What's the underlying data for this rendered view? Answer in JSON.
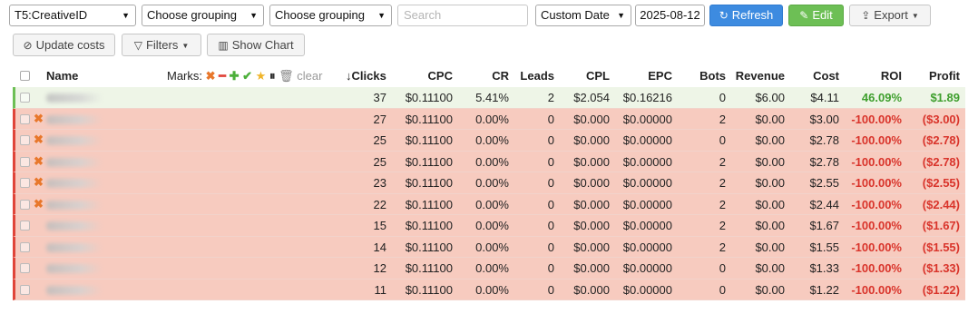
{
  "toolbar": {
    "grouping1": "T5:CreativeID",
    "grouping2": "Choose grouping",
    "grouping3": "Choose grouping",
    "search_placeholder": "Search",
    "date_range": "Custom Date",
    "date_value": "2025-08-12",
    "refresh_label": "Refresh",
    "edit_label": "Edit",
    "export_label": "Export"
  },
  "toolbar2": {
    "update_costs_label": "Update costs",
    "filters_label": "Filters",
    "show_chart_label": "Show Chart"
  },
  "colors": {
    "accent_blue": "#3d8be0",
    "accent_green": "#6dbf55",
    "row_red": "#f7cbbf",
    "row_green": "#eef5e7",
    "positive": "#3f9f2e",
    "negative": "#d9342b"
  },
  "table": {
    "headers": {
      "name": "Name",
      "marks": "Marks:",
      "marks_clear": "clear",
      "clicks": "Clicks",
      "cpc": "CPC",
      "cr": "CR",
      "leads": "Leads",
      "cpl": "CPL",
      "epc": "EPC",
      "bots": "Bots",
      "revenue": "Revenue",
      "cost": "Cost",
      "roi": "ROI",
      "profit": "Profit"
    },
    "sort_icon": "arrow-down-icon",
    "rows": [
      {
        "status": "green",
        "mark": "",
        "clicks": "37",
        "cpc": "$0.11100",
        "cr": "5.41%",
        "leads": "2",
        "cpl": "$2.054",
        "epc": "$0.16216",
        "bots": "0",
        "revenue": "$6.00",
        "cost": "$4.11",
        "roi": "46.09%",
        "profit": "$1.89"
      },
      {
        "status": "red",
        "mark": "✖",
        "clicks": "27",
        "cpc": "$0.11100",
        "cr": "0.00%",
        "leads": "0",
        "cpl": "$0.000",
        "epc": "$0.00000",
        "bots": "2",
        "revenue": "$0.00",
        "cost": "$3.00",
        "roi": "-100.00%",
        "profit": "($3.00)"
      },
      {
        "status": "red",
        "mark": "✖",
        "clicks": "25",
        "cpc": "$0.11100",
        "cr": "0.00%",
        "leads": "0",
        "cpl": "$0.000",
        "epc": "$0.00000",
        "bots": "0",
        "revenue": "$0.00",
        "cost": "$2.78",
        "roi": "-100.00%",
        "profit": "($2.78)"
      },
      {
        "status": "red",
        "mark": "✖",
        "clicks": "25",
        "cpc": "$0.11100",
        "cr": "0.00%",
        "leads": "0",
        "cpl": "$0.000",
        "epc": "$0.00000",
        "bots": "2",
        "revenue": "$0.00",
        "cost": "$2.78",
        "roi": "-100.00%",
        "profit": "($2.78)"
      },
      {
        "status": "red",
        "mark": "✖",
        "clicks": "23",
        "cpc": "$0.11100",
        "cr": "0.00%",
        "leads": "0",
        "cpl": "$0.000",
        "epc": "$0.00000",
        "bots": "2",
        "revenue": "$0.00",
        "cost": "$2.55",
        "roi": "-100.00%",
        "profit": "($2.55)"
      },
      {
        "status": "red",
        "mark": "✖",
        "clicks": "22",
        "cpc": "$0.11100",
        "cr": "0.00%",
        "leads": "0",
        "cpl": "$0.000",
        "epc": "$0.00000",
        "bots": "2",
        "revenue": "$0.00",
        "cost": "$2.44",
        "roi": "-100.00%",
        "profit": "($2.44)"
      },
      {
        "status": "red",
        "mark": "",
        "clicks": "15",
        "cpc": "$0.11100",
        "cr": "0.00%",
        "leads": "0",
        "cpl": "$0.000",
        "epc": "$0.00000",
        "bots": "2",
        "revenue": "$0.00",
        "cost": "$1.67",
        "roi": "-100.00%",
        "profit": "($1.67)"
      },
      {
        "status": "red",
        "mark": "",
        "clicks": "14",
        "cpc": "$0.11100",
        "cr": "0.00%",
        "leads": "0",
        "cpl": "$0.000",
        "epc": "$0.00000",
        "bots": "2",
        "revenue": "$0.00",
        "cost": "$1.55",
        "roi": "-100.00%",
        "profit": "($1.55)"
      },
      {
        "status": "red",
        "mark": "",
        "clicks": "12",
        "cpc": "$0.11100",
        "cr": "0.00%",
        "leads": "0",
        "cpl": "$0.000",
        "epc": "$0.00000",
        "bots": "0",
        "revenue": "$0.00",
        "cost": "$1.33",
        "roi": "-100.00%",
        "profit": "($1.33)"
      },
      {
        "status": "red",
        "mark": "",
        "clicks": "11",
        "cpc": "$0.11100",
        "cr": "0.00%",
        "leads": "0",
        "cpl": "$0.000",
        "epc": "$0.00000",
        "bots": "0",
        "revenue": "$0.00",
        "cost": "$1.22",
        "roi": "-100.00%",
        "profit": "($1.22)"
      }
    ]
  }
}
